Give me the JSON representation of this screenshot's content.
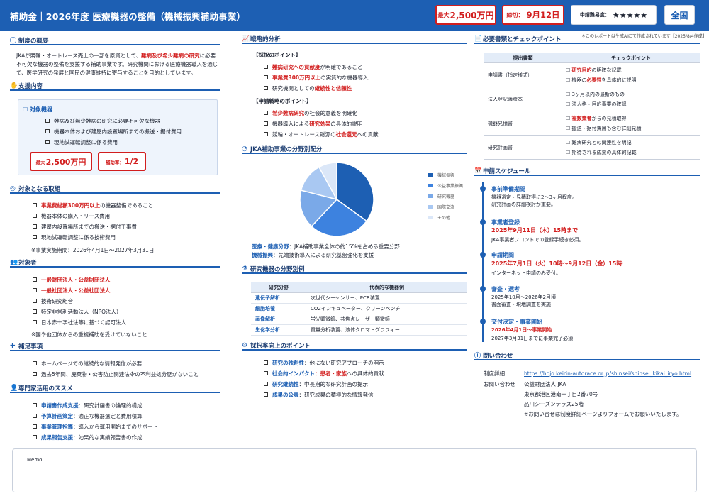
{
  "header": {
    "title": "補助金｜2026年度 医療機器の整備（機械振興補助事業）",
    "max_prefix": "最大",
    "max_amount": "2,500万円",
    "deadline_prefix": "締切：",
    "deadline": "9月12日",
    "difficulty_label": "申請難易度：",
    "difficulty_stars": "★★★★★",
    "region": "全国"
  },
  "note": "＊このレポートは生成AIにて作成されています【2025/8/4作成】",
  "overview": {
    "title": "制度の概要",
    "text_a": "JKAが競輪・オートレース売上の一部を原資として、",
    "text_b": "難病及び希少難病の研究",
    "text_c": "に必要不可欠な機器の整備を支援する補助事業です。研究機関における医療機器導入を通じて、医学研究の発展と国民の健康維持に寄与することを目的としています。"
  },
  "support": {
    "title": "支援内容",
    "box_title": "対象機器",
    "items": [
      "難病及び希少難病の研究に必要不可欠な機器",
      "機器本体および建屋内設置場所までの搬送・据付費用",
      "現地試運転調整に係る費用"
    ],
    "max_prefix": "最大",
    "max_amount": "2,500万円",
    "rate_label": "補助率：",
    "rate": "1/2"
  },
  "targets": {
    "title": "対象となる取組",
    "items": [
      [
        "事業費総額300万円以上",
        "の機器整備であること"
      ],
      [
        "",
        "機器本体の購入・リース費用"
      ],
      [
        "",
        "建屋内設置場所までの搬送・据付工事費"
      ],
      [
        "",
        "現地試運転調整に係る技術費用"
      ]
    ],
    "note": "※事業実施期間：2026年4月1日〜2027年3月31日"
  },
  "eligible": {
    "title": "対象者",
    "items": [
      [
        "一般財団法人・公益財団法人",
        ""
      ],
      [
        "一般社団法人・公益社団法人",
        ""
      ],
      [
        "",
        "技術研究組合"
      ],
      [
        "",
        "特定非営利活動法人（NPO法人）"
      ],
      [
        "",
        "日本赤十字社法等に基づく認可法人"
      ]
    ],
    "note": "※国や他団体からの重複補助を受けていないこと"
  },
  "supplement": {
    "title": "補足事項",
    "items": [
      "ホームページでの継続的な情報発信が必要",
      "過去5年間、廃棄物・公害防止関連法令の不利益処分歴がないこと"
    ]
  },
  "expert": {
    "title": "専門家活用のススメ",
    "items": [
      [
        "申請書作成支援",
        "：研究計画書の論理的構成"
      ],
      [
        "予算計画策定",
        "：適正な機器選定と費用積算"
      ],
      [
        "事業管理指導",
        "：導入から運用開始までのサポート"
      ],
      [
        "成果報告支援",
        "：効果的な実績報告書の作成"
      ]
    ]
  },
  "strategy": {
    "title": "戦略的分析",
    "h1": "【採択のポイント】",
    "p1": [
      [
        "難病研究への貢献度",
        "が明確であること"
      ],
      [
        "事業費300万円以上",
        "の実質的な機器導入"
      ],
      [
        "研究機関としての",
        "継続性と信頼性"
      ]
    ],
    "h2": "【申請戦略のポイント】",
    "p2": [
      [
        "希少難病研究",
        "の社会的意義を明確化"
      ],
      [
        "機器導入による",
        "研究効果",
        "の具体的説明"
      ],
      [
        "競輪・オートレース財源の",
        "社会還元",
        "への貢献"
      ]
    ]
  },
  "pie": {
    "title": "JKA補助事業の分野別配分",
    "caption1_b": "医療・健康分野",
    "caption1": "：JKA補助事業全体の約15%を占める重要分野",
    "caption2_b": "機械振興",
    "caption2": "：先端技術導入による研究基盤強化を支援"
  },
  "chart_data": {
    "type": "pie",
    "categories": [
      "機械振興",
      "公益事業振興",
      "研究機器",
      "国際交流",
      "その他"
    ],
    "values": [
      35,
      27,
      17,
      13,
      8
    ],
    "colors": [
      "#1d5fb3",
      "#3d82df",
      "#7aa9e8",
      "#a9c8f2",
      "#dbe7f8"
    ]
  },
  "fields": {
    "title": "研究機器の分野別例",
    "headers": [
      "研究分野",
      "代表的な機器例"
    ],
    "rows": [
      [
        "遺伝子解析",
        "次世代シーケンサー、PCR装置"
      ],
      [
        "細胞培養",
        "CO2インキュベーター、クリーンベンチ"
      ],
      [
        "画像解析",
        "蛍光顕微鏡、共焦点レーザー顕微鏡"
      ],
      [
        "生化学分析",
        "質量分析装置、液体クロマトグラフィー"
      ]
    ]
  },
  "improve": {
    "title": "採択率向上のポイント",
    "items": [
      [
        "研究の独創性",
        "：他にない研究アプローチの明示"
      ],
      [
        "社会的インパクト",
        "：患者・家族",
        "への具体的貢献"
      ],
      [
        "研究継続性",
        "：中長期的な研究計画の提示"
      ],
      [
        "成果の公表",
        "：研究成果の積極的な情報発信"
      ]
    ]
  },
  "docs": {
    "title": "必要書類とチェックポイント",
    "headers": [
      "提出書類",
      "チェックポイント"
    ],
    "rows": [
      {
        "doc": "申請書（指定様式）",
        "checks": [
          [
            "研究目的",
            "の明確な記載"
          ],
          [
            "機器の",
            "必要性",
            "を具体的に説明"
          ]
        ]
      },
      {
        "doc": "法人登記簿謄本",
        "checks": [
          [
            "",
            "3ヶ月以内の最新のもの"
          ],
          [
            "",
            "法人格・目的事業の確認"
          ]
        ]
      },
      {
        "doc": "機器見積書",
        "checks": [
          [
            "複数業者",
            "からの見積取得"
          ],
          [
            "",
            "搬送・据付費用も含む詳細見積"
          ]
        ]
      },
      {
        "doc": "研究計画書",
        "checks": [
          [
            "",
            "難病研究との関連性を明記"
          ],
          [
            "",
            "期待される成果の具体的記載"
          ]
        ]
      }
    ]
  },
  "schedule": {
    "title": "申請スケジュール",
    "items": [
      {
        "t": "事前準備期間",
        "lines": [
          "機器選定・見積取得に2〜3ヶ月程度。",
          "研究計画の詳細検討が重要。"
        ],
        "hl": ""
      },
      {
        "t": "事業者登録",
        "hl": "2025年9月11日（木）15時まで",
        "lines": [
          "JKA事業者フロントでの登録手続き必須。"
        ]
      },
      {
        "t": "申請期間",
        "hl": "2025年7月1日（火）10時〜9月12日（金）15時",
        "lines": [
          "インターネット申請のみ受付。"
        ]
      },
      {
        "t": "審査・選考",
        "hl": "",
        "lines": [
          "2025年10月〜2026年2月頃",
          "書面審査・現地調査を実施"
        ]
      },
      {
        "t": "交付決定・事業開始",
        "hl": "2026年4月1日〜事業開始",
        "lines": [
          "2027年3月31日までに事業完了必須"
        ]
      }
    ]
  },
  "contact": {
    "title": "問い合わせ",
    "detail_label": "制度詳細",
    "url": "https://hojo.keirin-autorace.or.jp/shinsei/shinsei_kikai_iryo.html",
    "contact_label": "お問い合わせ",
    "lines": [
      "公益財団法人 JKA",
      "東京都港区港南一丁目2番70号",
      "品川シーズンテラス25階",
      "※お問い合せは制度詳細ページよりフォームでお願いいたします。"
    ]
  },
  "memo": {
    "label": "Memo"
  }
}
